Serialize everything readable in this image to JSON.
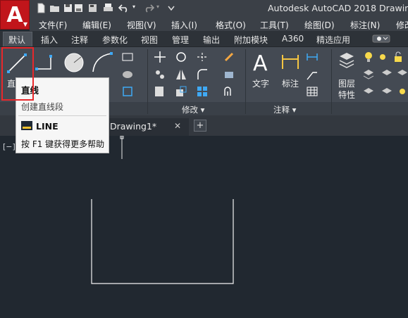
{
  "titlebar": {
    "title": "Autodesk AutoCAD 2018    Drawin"
  },
  "app_button": {
    "letter": "A"
  },
  "menubar": {
    "items": [
      "文件(F)",
      "编辑(E)",
      "视图(V)",
      "插入(I)",
      "格式(O)",
      "工具(T)",
      "绘图(D)",
      "标注(N)",
      "修改"
    ]
  },
  "ribbon_tabs": {
    "items": [
      "默认",
      "插入",
      "注释",
      "参数化",
      "视图",
      "管理",
      "输出",
      "附加模块",
      "A360",
      "精选应用"
    ]
  },
  "ribbon": {
    "line_tool_label": "直",
    "text_label": "文字",
    "dimension_label": "标注",
    "layer_props_label_1": "图层",
    "layer_props_label_2": "特性",
    "panel_modify": "修改 ▾",
    "panel_annotation": "注释 ▾"
  },
  "tooltip": {
    "title": "直线",
    "description": "创建直线段",
    "command": "LINE",
    "help": "按 F1 键获得更多帮助"
  },
  "doc_tabs": {
    "active": "Drawing1*",
    "close": "✕",
    "new": "+"
  },
  "canvas": {
    "viewport_label": "[−]["
  },
  "colors": {
    "accent_red": "#e8282b",
    "app_red": "#c1151b",
    "canvas_bg": "#212830"
  }
}
